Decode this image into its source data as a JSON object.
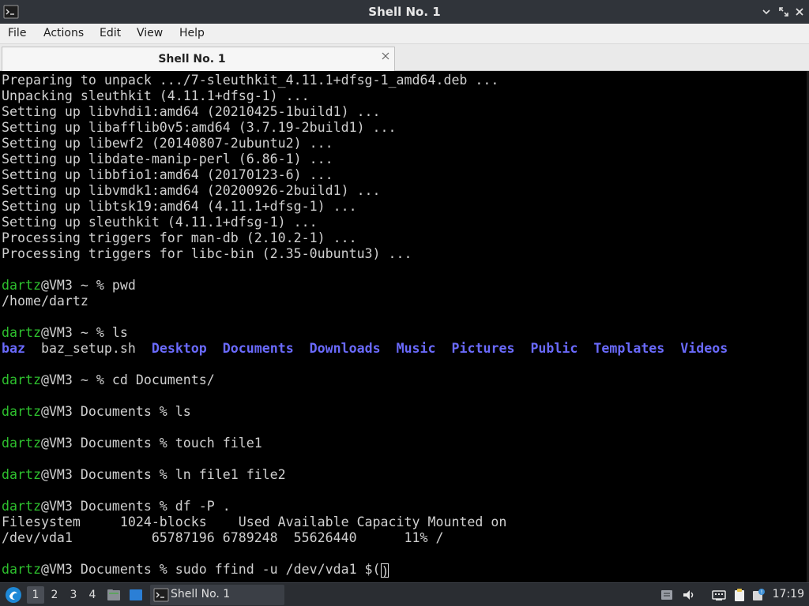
{
  "window": {
    "title": "Shell No. 1",
    "controls": [
      "minimize-icon",
      "maximize-icon",
      "close-icon"
    ]
  },
  "menubar": {
    "items": [
      "File",
      "Actions",
      "Edit",
      "View",
      "Help"
    ]
  },
  "tabs": [
    {
      "label": "Shell No. 1",
      "active": true
    }
  ],
  "terminal": {
    "colors": {
      "background": "#000000",
      "text": "#d0d0d0",
      "user": "#2ec12e",
      "directory": "#6a6afc"
    },
    "lines": [
      [
        {
          "t": "Preparing to unpack .../7-sleuthkit_4.11.1+dfsg-1_amd64.deb ..."
        }
      ],
      [
        {
          "t": "Unpacking sleuthkit (4.11.1+dfsg-1) ..."
        }
      ],
      [
        {
          "t": "Setting up libvhdi1:amd64 (20210425-1build1) ..."
        }
      ],
      [
        {
          "t": "Setting up libafflib0v5:amd64 (3.7.19-2build1) ..."
        }
      ],
      [
        {
          "t": "Setting up libewf2 (20140807-2ubuntu2) ..."
        }
      ],
      [
        {
          "t": "Setting up libdate-manip-perl (6.86-1) ..."
        }
      ],
      [
        {
          "t": "Setting up libbfio1:amd64 (20170123-6) ..."
        }
      ],
      [
        {
          "t": "Setting up libvmdk1:amd64 (20200926-2build1) ..."
        }
      ],
      [
        {
          "t": "Setting up libtsk19:amd64 (4.11.1+dfsg-1) ..."
        }
      ],
      [
        {
          "t": "Setting up sleuthkit (4.11.1+dfsg-1) ..."
        }
      ],
      [
        {
          "t": "Processing triggers for man-db (2.10.2-1) ..."
        }
      ],
      [
        {
          "t": "Processing triggers for libc-bin (2.35-0ubuntu3) ..."
        }
      ],
      [],
      [
        {
          "t": "dartz",
          "c": "user"
        },
        {
          "t": "@VM3 ~ % pwd"
        }
      ],
      [
        {
          "t": "/home/dartz"
        }
      ],
      [],
      [
        {
          "t": "dartz",
          "c": "user"
        },
        {
          "t": "@VM3 ~ % ls"
        }
      ],
      [
        {
          "t": "baz",
          "c": "dir"
        },
        {
          "t": "  baz_setup.sh  "
        },
        {
          "t": "Desktop",
          "c": "dir"
        },
        {
          "t": "  "
        },
        {
          "t": "Documents",
          "c": "dir"
        },
        {
          "t": "  "
        },
        {
          "t": "Downloads",
          "c": "dir"
        },
        {
          "t": "  "
        },
        {
          "t": "Music",
          "c": "dir"
        },
        {
          "t": "  "
        },
        {
          "t": "Pictures",
          "c": "dir"
        },
        {
          "t": "  "
        },
        {
          "t": "Public",
          "c": "dir"
        },
        {
          "t": "  "
        },
        {
          "t": "Templates",
          "c": "dir"
        },
        {
          "t": "  "
        },
        {
          "t": "Videos",
          "c": "dir"
        }
      ],
      [],
      [
        {
          "t": "dartz",
          "c": "user"
        },
        {
          "t": "@VM3 ~ % cd Documents/"
        }
      ],
      [],
      [
        {
          "t": "dartz",
          "c": "user"
        },
        {
          "t": "@VM3 Documents % ls"
        }
      ],
      [],
      [
        {
          "t": "dartz",
          "c": "user"
        },
        {
          "t": "@VM3 Documents % touch file1"
        }
      ],
      [],
      [
        {
          "t": "dartz",
          "c": "user"
        },
        {
          "t": "@VM3 Documents % ln file1 file2"
        }
      ],
      [],
      [
        {
          "t": "dartz",
          "c": "user"
        },
        {
          "t": "@VM3 Documents % df -P ."
        }
      ],
      [
        {
          "t": "Filesystem     1024-blocks    Used Available Capacity Mounted on"
        }
      ],
      [
        {
          "t": "/dev/vda1          65787196 6789248  55626440      11% /"
        }
      ],
      [],
      [
        {
          "t": "dartz",
          "c": "user"
        },
        {
          "t": "@VM3 Documents % sudo ffind -u /dev/vda1 $("
        },
        {
          "t": ")",
          "c": "cursor"
        }
      ]
    ]
  },
  "taskbar": {
    "start_icon": "lxqt-menu-icon",
    "workspaces": [
      "1",
      "2",
      "3",
      "4"
    ],
    "active_workspace": "1",
    "task_label": "Shell No. 1",
    "tray_icons": [
      "monitor-icon",
      "volume-icon",
      "network-icon",
      "clipboard-icon",
      "updates-icon"
    ],
    "clock": "17:19"
  }
}
